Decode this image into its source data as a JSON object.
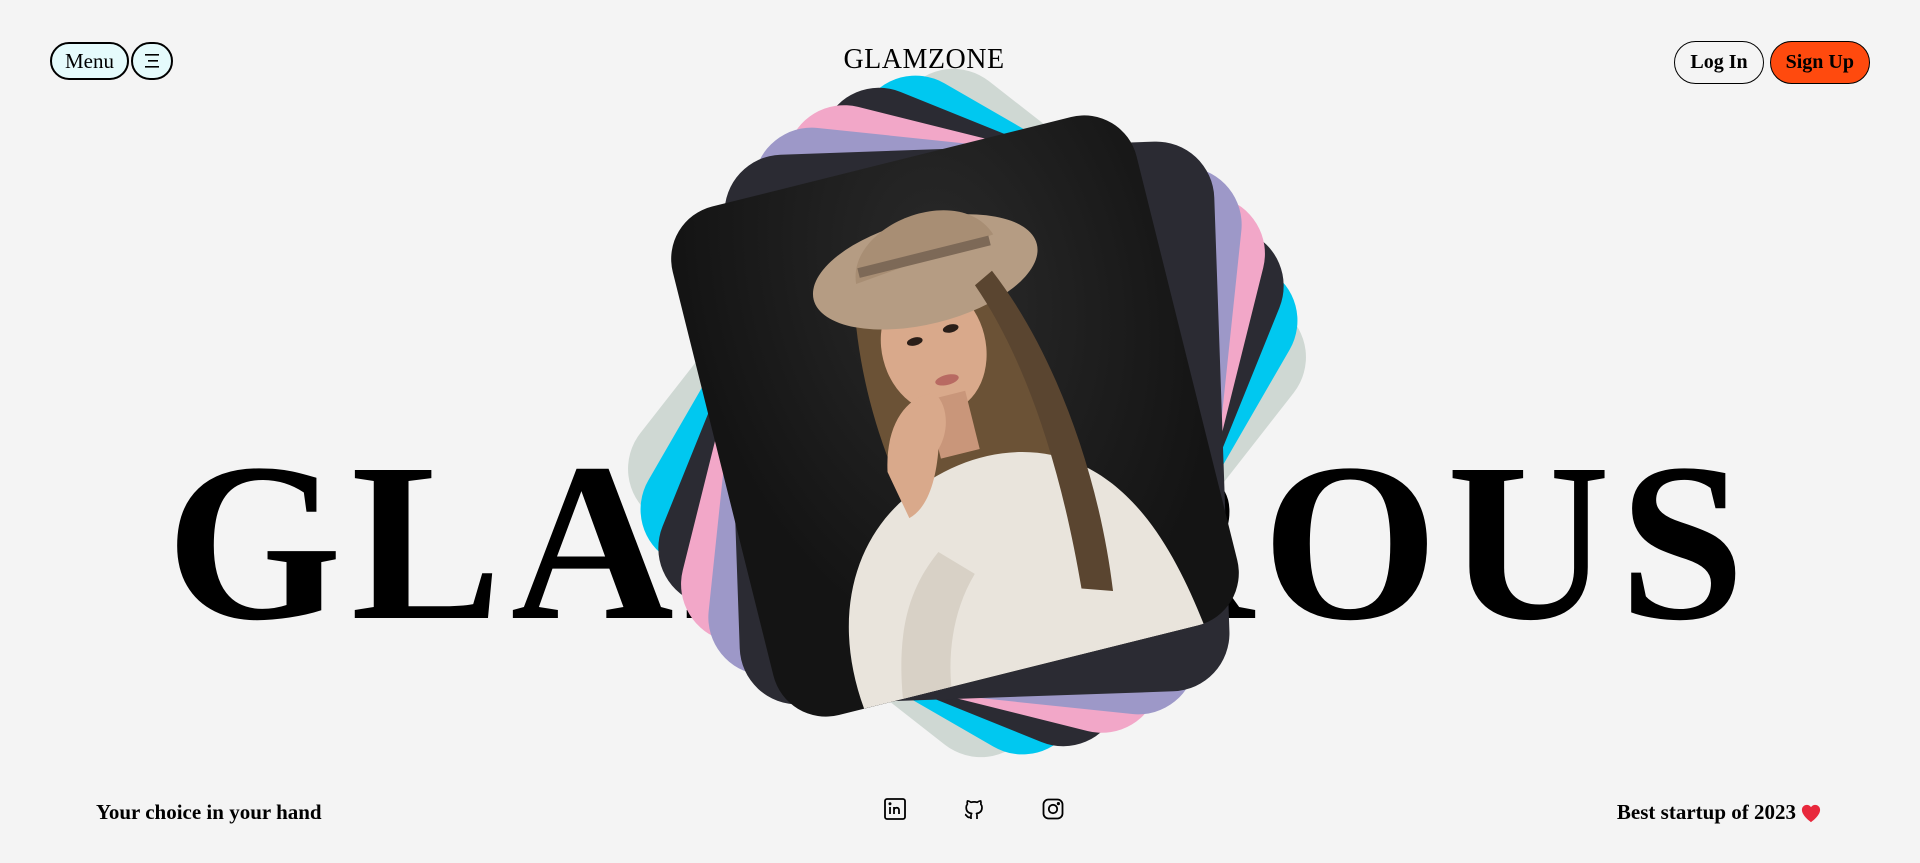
{
  "header": {
    "menu_label": "Menu",
    "brand": "GLAMZONE",
    "login_label": "Log In",
    "signup_label": "Sign Up"
  },
  "hero": {
    "headline": "GLAMOROUS",
    "stack_colors": [
      "#cfd8d3",
      "#00c8f0",
      "#2b2b33",
      "#f2a7c8",
      "#9d98c8",
      "#2b2b33"
    ],
    "photo_subject": "woman-in-hat-portrait"
  },
  "footer": {
    "tagline": "Your choice in your hand",
    "socials": [
      "linkedin-icon",
      "github-icon",
      "instagram-icon"
    ],
    "award_text": "Best startup of 2023",
    "award_icon": "heart-icon"
  },
  "colors": {
    "background": "#f4f4f4",
    "menu_bg": "#e5fbfc",
    "signup_bg": "#ff4a0e"
  }
}
